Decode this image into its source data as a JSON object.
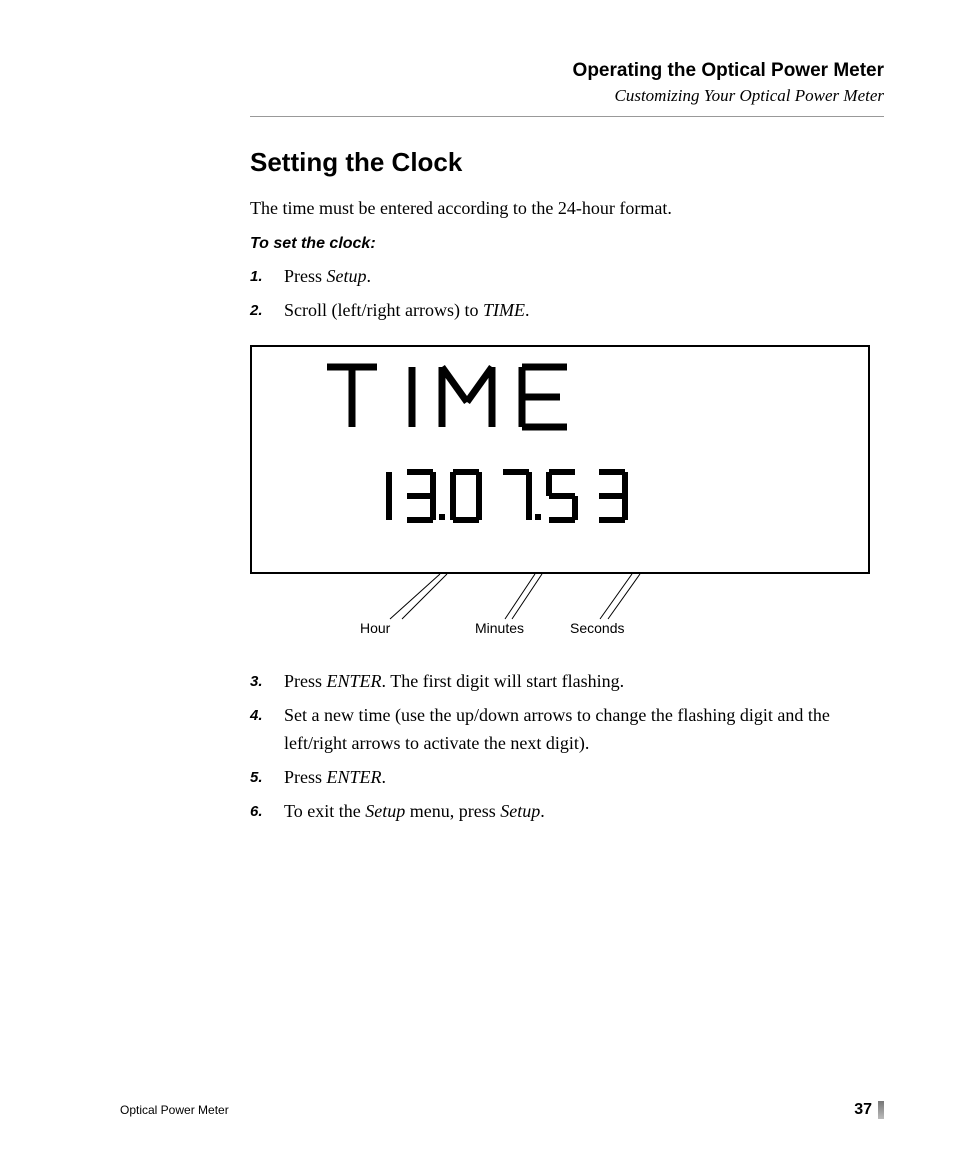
{
  "header": {
    "chapter": "Operating the Optical Power Meter",
    "subtitle": "Customizing Your Optical Power Meter"
  },
  "section_title": "Setting the Clock",
  "intro": "The time must be entered according to the 24-hour format.",
  "subhead": "To set the clock:",
  "steps_a": [
    {
      "pre": "Press ",
      "em": "Setup",
      "post": "."
    },
    {
      "pre": "Scroll (left/right arrows) to ",
      "em": "TIME",
      "post": "."
    }
  ],
  "figure": {
    "label": "TIME",
    "value": "13.07.53",
    "callouts": {
      "hour": "Hour",
      "minutes": "Minutes",
      "seconds": "Seconds"
    }
  },
  "steps_b": [
    {
      "n": "3",
      "pre": "Press ",
      "em": "ENTER",
      "post": ". The first digit will start flashing."
    },
    {
      "n": "4",
      "pre": "Set a new time (use the up/down arrows to change the flashing digit and the left/right arrows to activate the next digit).",
      "em": "",
      "post": ""
    },
    {
      "n": "5",
      "pre": "Press ",
      "em": "ENTER",
      "post": "."
    },
    {
      "n": "6",
      "pre": "To exit the ",
      "em": "Setup",
      "mid": " menu, press ",
      "em2": "Setup",
      "post": "."
    }
  ],
  "footer": {
    "left": "Optical Power Meter",
    "page": "37"
  }
}
